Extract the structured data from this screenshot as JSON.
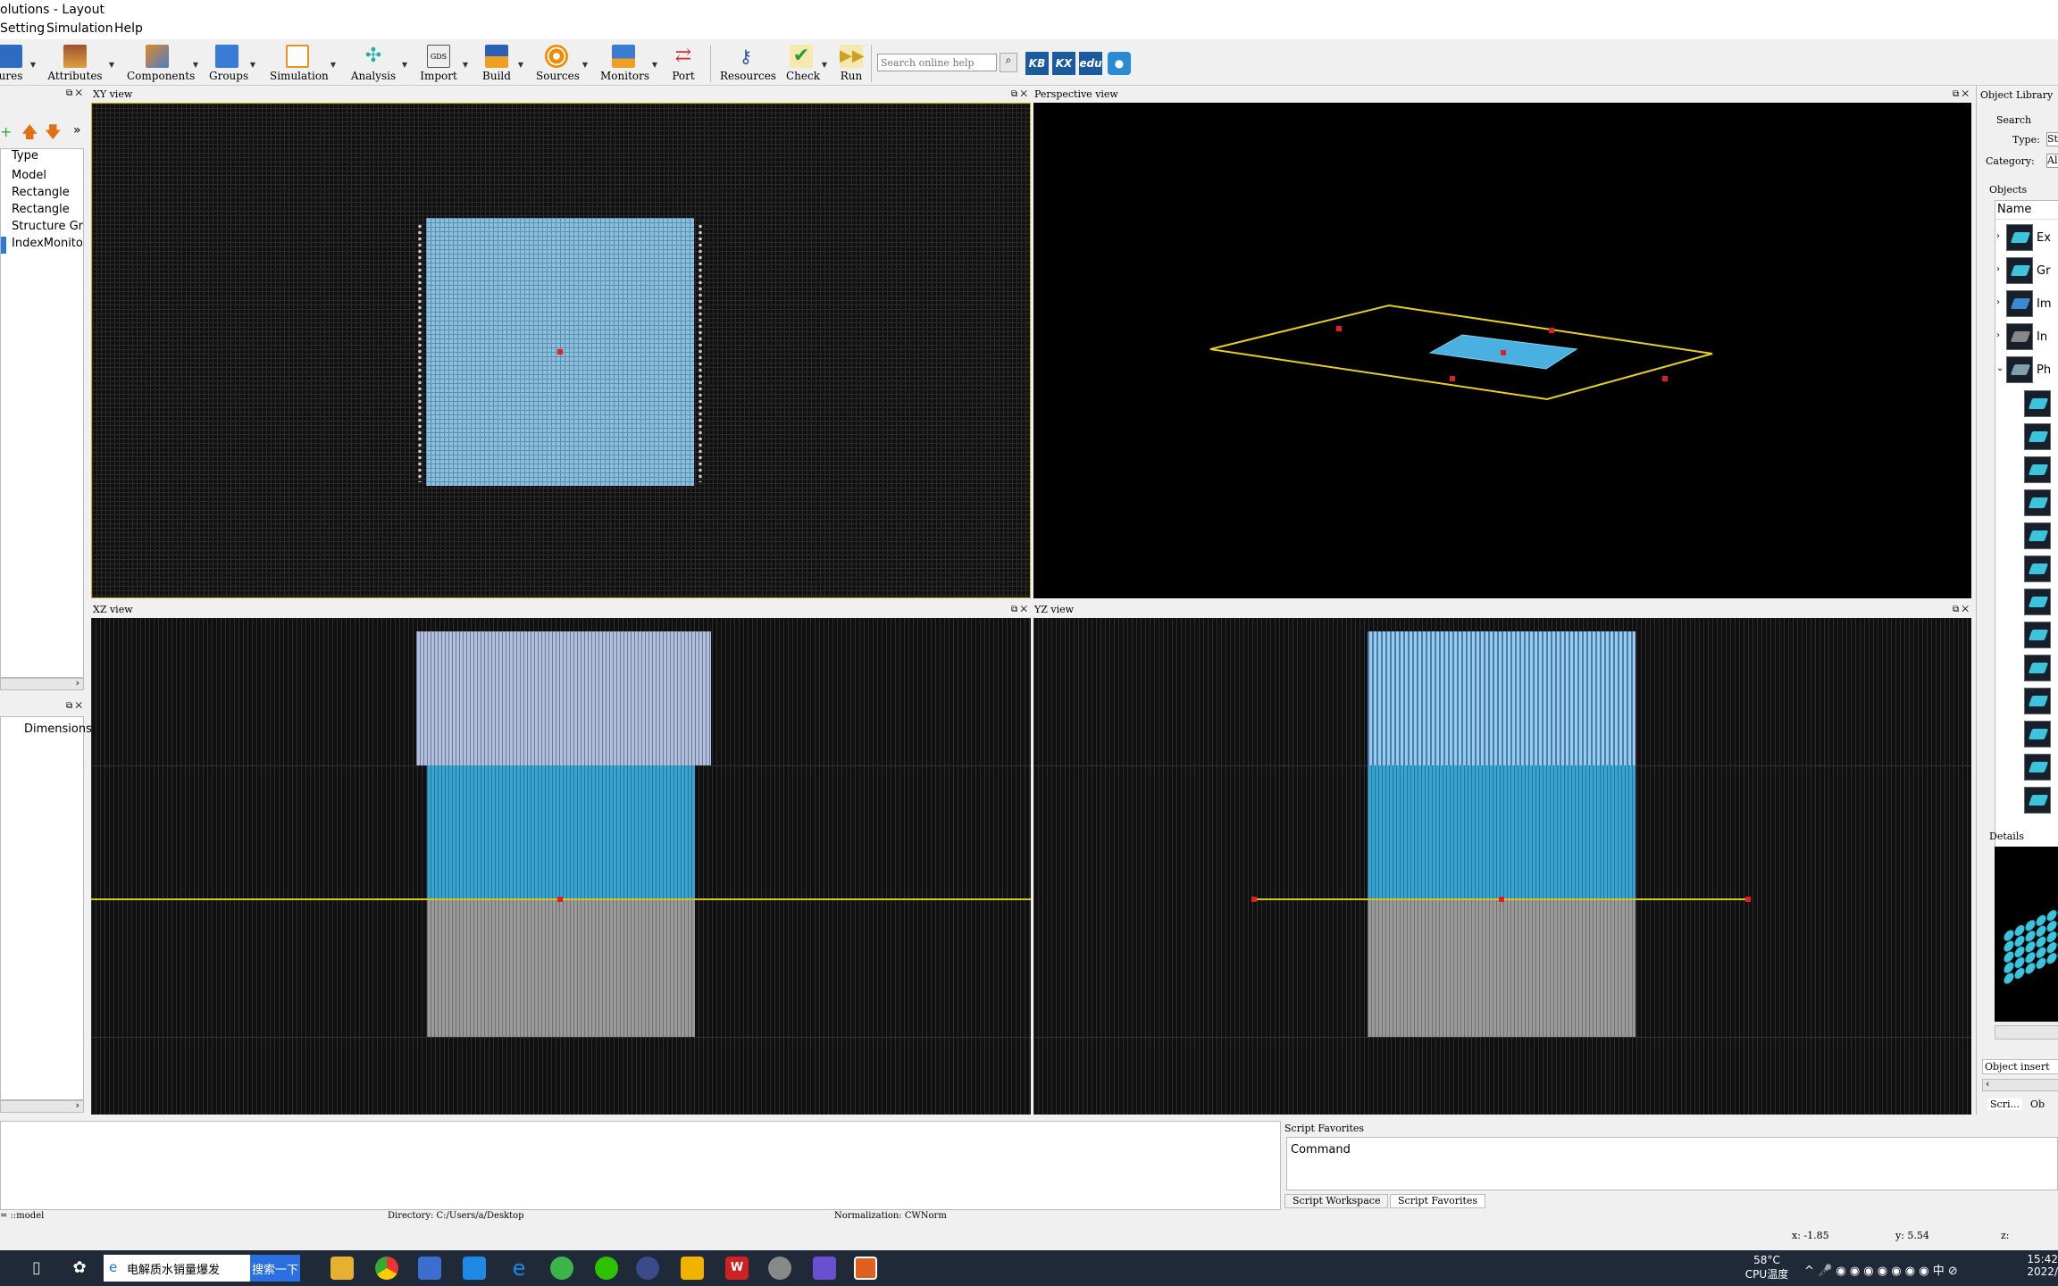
{
  "window": {
    "title": "olutions - Layout"
  },
  "menu": [
    "Setting",
    "Simulation",
    "Help"
  ],
  "toolbar": {
    "items": [
      {
        "label": "ures"
      },
      {
        "label": "Attributes"
      },
      {
        "label": "Components"
      },
      {
        "label": "Groups"
      },
      {
        "label": "Simulation"
      },
      {
        "label": "Analysis"
      },
      {
        "label": "Import"
      },
      {
        "label": "Build"
      },
      {
        "label": "Sources"
      },
      {
        "label": "Monitors"
      },
      {
        "label": "Port"
      },
      {
        "label": "Resources"
      },
      {
        "label": "Check"
      },
      {
        "label": "Run"
      }
    ],
    "search_placeholder": "Search online help",
    "logos": [
      "KB",
      "KX",
      "edu"
    ]
  },
  "object_tree": {
    "header": "Type",
    "items": [
      "Model",
      "Rectangle",
      "Rectangle",
      "Structure Grou",
      "IndexMonitor"
    ],
    "selected": 4
  },
  "property_panel": {
    "header": "Dimensions"
  },
  "views": {
    "xy": "XY view",
    "perspective": "Perspective view",
    "xz": "XZ view",
    "yz": "YZ view"
  },
  "object_library": {
    "title": "Object Library",
    "search_label": "Search",
    "type_label": "Type:",
    "type_value": "St",
    "category_label": "Category:",
    "category_value": "Al",
    "objects_label": "Objects",
    "name_header": "Name",
    "groups": [
      "Ex",
      "Gr",
      "Im",
      "In",
      "Ph"
    ],
    "details_label": "Details",
    "insert_label": "Object insert",
    "tabs": [
      "Scri...",
      "Ob"
    ]
  },
  "console": {
    "text": ""
  },
  "script_favorites": {
    "title": "Script Favorites",
    "column": "Command",
    "tabs": [
      "Script Workspace",
      "Script Favorites"
    ]
  },
  "status": {
    "model": "= ::model",
    "directory": "Directory: C:/Users/a/Desktop",
    "normalization": "Normalization: CWNorm",
    "x": "x: -1.85",
    "y": "y: 5.54",
    "z": "z:"
  },
  "taskbar": {
    "search_text": "电解质水销量爆发",
    "search_button": "搜索一下",
    "temp": "58°C",
    "temp_label": "CPU温度",
    "lang": "中",
    "time": "15:42",
    "date": "2022/"
  }
}
